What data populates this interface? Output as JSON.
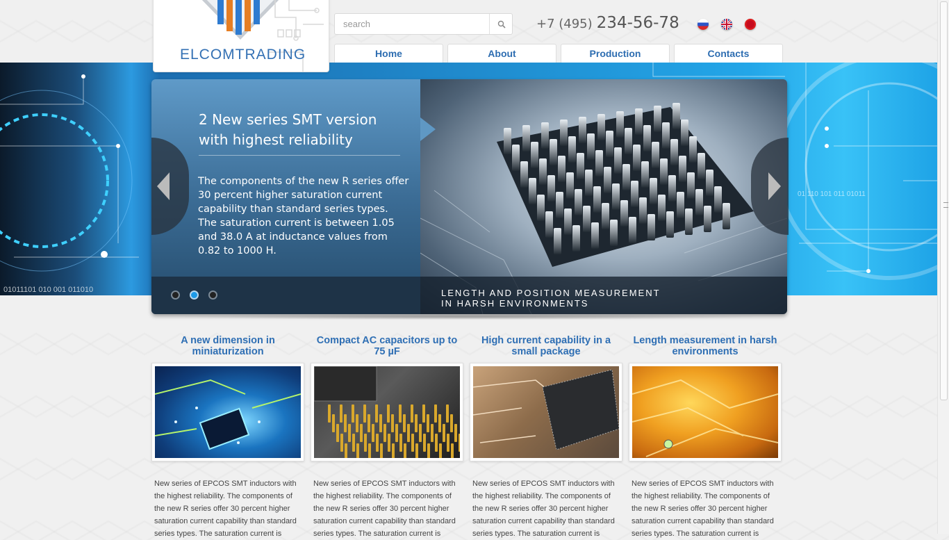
{
  "brand": {
    "name": "ELCOMTRADING"
  },
  "search": {
    "placeholder": "search"
  },
  "contact": {
    "phone_code": "+7 (495)",
    "phone_number": "234-56-78"
  },
  "languages": [
    "russian-flag-icon",
    "uk-flag-icon",
    "japan-flag-icon"
  ],
  "nav": {
    "items": [
      {
        "label": "Home"
      },
      {
        "label": "About"
      },
      {
        "label": "Production"
      },
      {
        "label": "Contacts"
      }
    ]
  },
  "slider": {
    "title": "2 New series SMT version with highest reliability",
    "text": "The components of the new R series offer 30 percent higher saturation current capability than standard series types. The saturation current is between 1.05 and 38.0 A at inductance values from 0.82 to 1000 H.",
    "caption_line1": "LENGTH AND POSITION MEASUREMENT",
    "caption_line2": "IN HARSH ENVIRONMENTS",
    "active_slide": 2,
    "slide_count": 3
  },
  "cards": [
    {
      "title": "A new dimension in miniaturization",
      "text": "New series of EPCOS SMT inductors with the highest reliability. The components of the new R series offer 30 percent higher saturation current capability than standard series types. The saturation current is"
    },
    {
      "title": "Compact AC capacitors up to 75 µF",
      "text": "New series of EPCOS SMT inductors with the highest reliability. The components of the new R series offer 30 percent higher saturation current capability than standard series types. The saturation current is"
    },
    {
      "title": "High current capability in a small package",
      "text": "New series of EPCOS SMT inductors with the highest reliability. The components of the new R series offer 30 percent higher saturation current capability than standard series types. The saturation current is"
    },
    {
      "title": "Length measurement in harsh environments",
      "text": "New series of EPCOS SMT inductors with the highest reliability. The components of the new R series offer 30 percent higher saturation current capability than standard series types. The saturation current is"
    }
  ],
  "colors": {
    "accent": "#2f6fb4",
    "hero_blue": "#23a6e8",
    "active_dot": "#1c9ae8"
  }
}
